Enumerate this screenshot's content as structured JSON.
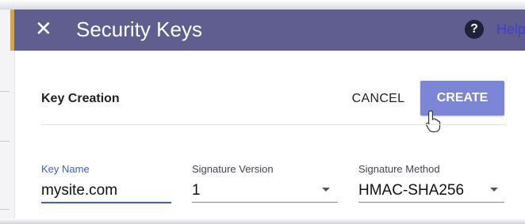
{
  "dialog": {
    "title": "Security Keys",
    "close_icon": "close-icon",
    "help_icon": "help-icon",
    "help_label": "Help"
  },
  "section": {
    "title": "Key Creation",
    "cancel_label": "CANCEL",
    "create_label": "CREATE"
  },
  "fields": {
    "key_name": {
      "label": "Key Name",
      "value": "mysite.com"
    },
    "signature_version": {
      "label": "Signature Version",
      "value": "1"
    },
    "signature_method": {
      "label": "Signature Method",
      "value": "HMAC-SHA256"
    }
  },
  "colors": {
    "title_bar": "#5f5e8f",
    "primary_button": "#7b87d6",
    "focus": "#3d5bd8"
  }
}
